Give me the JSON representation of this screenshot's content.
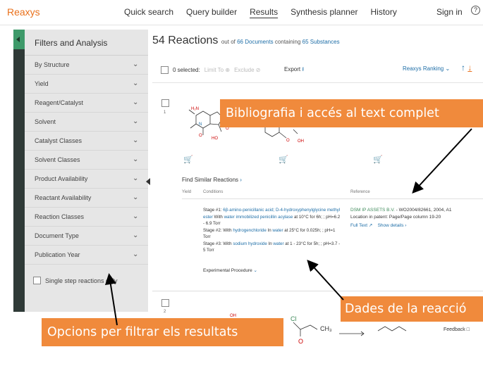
{
  "app": {
    "logo": "Reaxys"
  },
  "nav": {
    "items": [
      "Quick search",
      "Query builder",
      "Results",
      "Synthesis planner",
      "History"
    ],
    "active": "Results",
    "sign_in": "Sign in",
    "help": "?"
  },
  "sidebar": {
    "title": "Filters and Analysis",
    "facets": [
      "By Structure",
      "Yield",
      "Reagent/Catalyst",
      "Solvent",
      "Catalyst Classes",
      "Solvent Classes",
      "Product Availability",
      "Reactant Availability",
      "Reaction Classes",
      "Document Type",
      "Publication Year"
    ],
    "single_step": "Single step reactions only"
  },
  "results": {
    "count": "54 Reactions",
    "out_of": "out of",
    "documents": "66 Documents",
    "containing": "containing",
    "substances": "65 Substances"
  },
  "toolbar": {
    "selected": "0 selected:",
    "limit": "Limit To",
    "exclude": "Exclude",
    "export": "Export",
    "ranking": "Reaxys Ranking"
  },
  "reaction1": {
    "number": "1",
    "find_similar": "Find Similar Reactions",
    "columns": [
      "Yield",
      "Conditions",
      "Reference"
    ],
    "stage1_prefix": "Stage #1: ",
    "stage1_reagents": "6β-amino-penicillanic acid; D-4-hydroxyphenylglycine methyl ester",
    "stage1_with": " With ",
    "stage1_enzyme": "water immobilized penicillin acylase",
    "stage1_rest": " at 10°C for 6h; ; pH=6.2 - 6.9 Torr",
    "stage2_prefix": "Stage #2: With ",
    "stage2_reagent": "hydrogenchloride",
    "stage2_in": " In ",
    "stage2_solvent": "water",
    "stage2_rest": " at 25°C for 0.025h; ; pH=1 Torr",
    "stage3_prefix": "Stage #3: With ",
    "stage3_reagent": "sodium hydroxide",
    "stage3_in": " In ",
    "stage3_solvent": "water",
    "stage3_rest": " at 1 - 23°C for 5h; ; pH=3.7 - 5 Torr",
    "experimental": "Experimental Procedure",
    "ref_company": "DSM IP ASSETS B.V.",
    "ref_rest": " - WO2004/82661, 2004, A1",
    "ref_location": "Location in patent: Page/Page column 19-20",
    "full_text": "Full Text",
    "show_details": "Show details"
  },
  "reaction2": {
    "number": "2",
    "label_cl": "Cl",
    "label_ch3": "CH₃",
    "label_o": "O",
    "label_oh": "OH"
  },
  "feedback": "Feedback",
  "annotations": {
    "bibliography": "Bibliografia i accés al text complet",
    "reaction_data": "Dades de la reacció",
    "filter_options": "Opcions per filtrar els resultats"
  }
}
